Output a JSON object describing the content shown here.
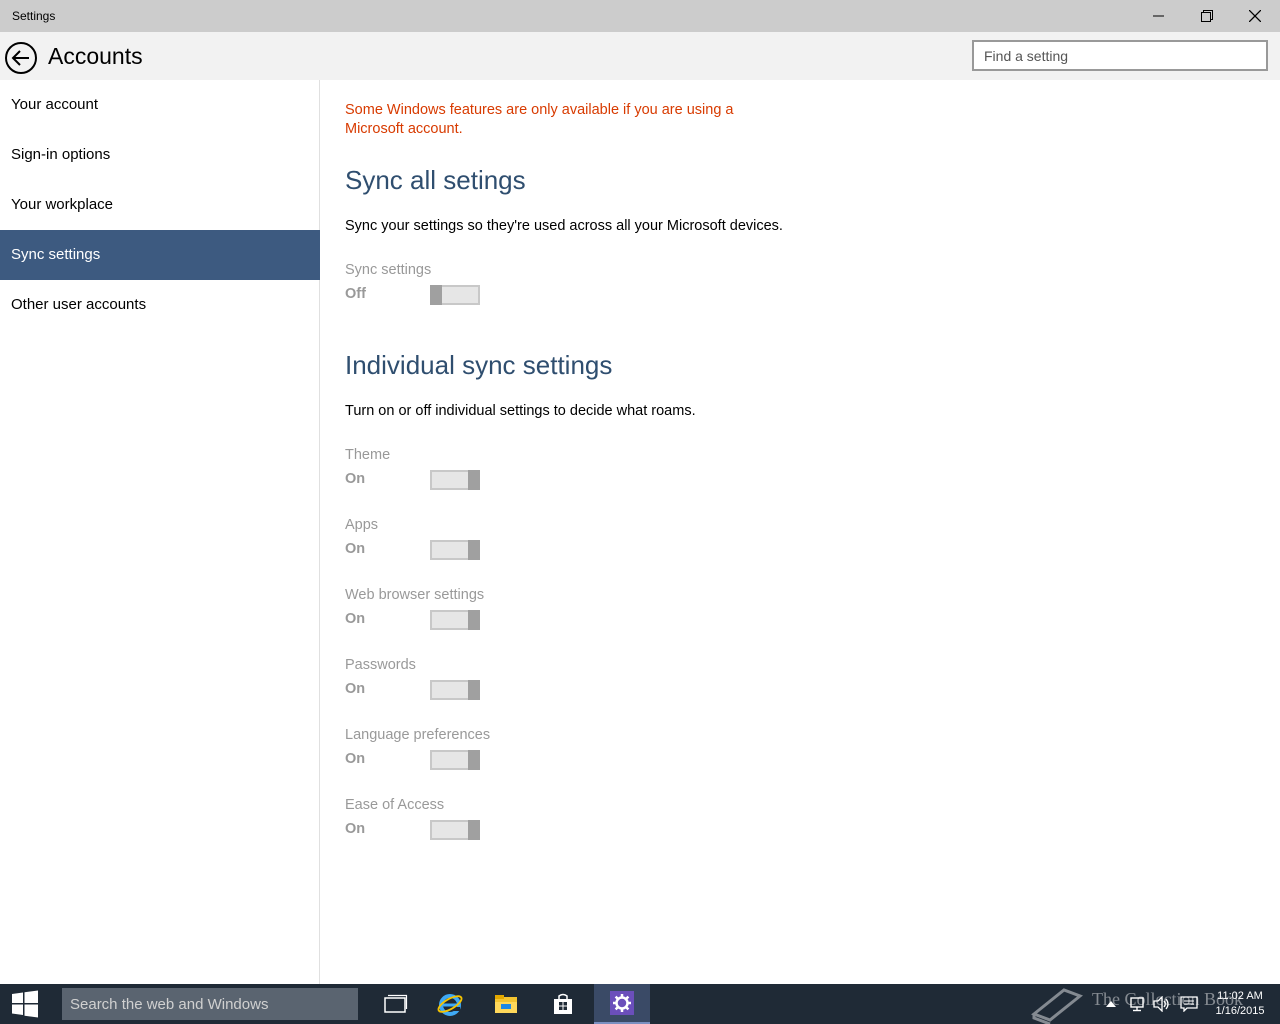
{
  "window": {
    "title": "Settings"
  },
  "header": {
    "title": "Accounts",
    "search_placeholder": "Find a setting"
  },
  "sidebar": {
    "items": [
      {
        "label": "Your account",
        "active": false
      },
      {
        "label": "Sign-in options",
        "active": false
      },
      {
        "label": "Your workplace",
        "active": false
      },
      {
        "label": "Sync settings",
        "active": true
      },
      {
        "label": "Other user accounts",
        "active": false
      }
    ]
  },
  "main": {
    "warning": "Some Windows features are only available if you are using a Microsoft account.",
    "sync_all": {
      "title": "Sync all setings",
      "description": "Sync your settings so they're used across all your Microsoft devices.",
      "setting": {
        "label": "Sync settings",
        "state": "Off"
      }
    },
    "individual": {
      "title": "Individual sync settings",
      "description": "Turn on or off individual settings to decide what roams.",
      "settings": [
        {
          "label": "Theme",
          "state": "On"
        },
        {
          "label": "Apps",
          "state": "On"
        },
        {
          "label": "Web browser settings",
          "state": "On"
        },
        {
          "label": "Passwords",
          "state": "On"
        },
        {
          "label": "Language preferences",
          "state": "On"
        },
        {
          "label": "Ease of Access",
          "state": "On"
        }
      ]
    }
  },
  "taskbar": {
    "search_placeholder": "Search the web and Windows",
    "watermark": "The Collection Book",
    "clock_time": "11:02 AM",
    "clock_date": "1/16/2015",
    "icons": [
      "task-view-icon",
      "internet-explorer-icon",
      "file-explorer-icon",
      "store-icon",
      "settings-icon"
    ]
  },
  "colors": {
    "accent": "#3d5a80",
    "warning": "#d83b01",
    "section_title": "#2f4e6f",
    "taskbar": "#1f2a36"
  }
}
